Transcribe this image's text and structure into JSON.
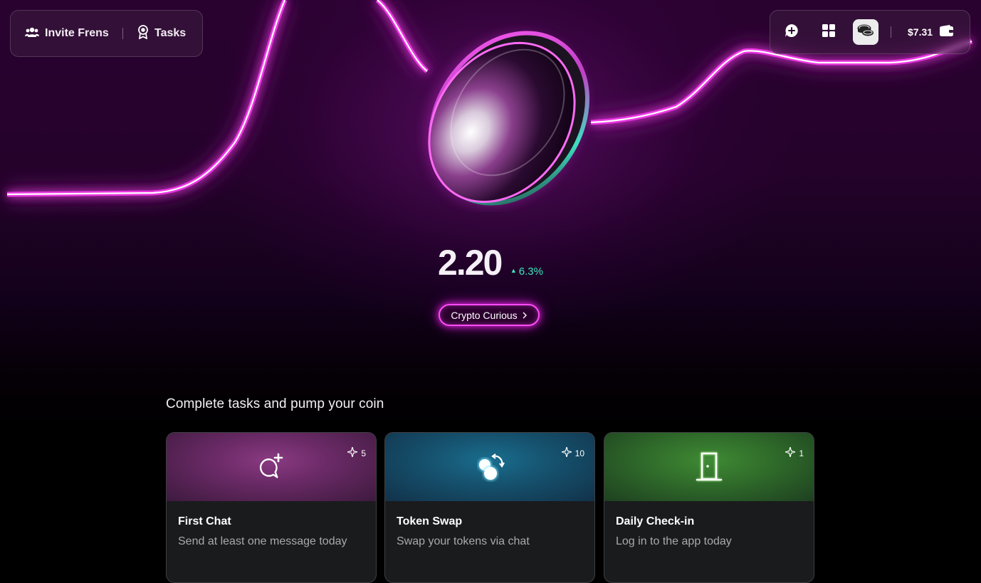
{
  "nav": {
    "invite_label": "Invite Frens",
    "tasks_label": "Tasks",
    "icons": [
      "people-icon",
      "award-icon"
    ]
  },
  "toolbar": {
    "balance": "$7.31",
    "icons": [
      "chat-plus-icon",
      "grid-icon",
      "coins-icon",
      "wallet-icon"
    ],
    "active_icon": "coins-icon"
  },
  "coin": {
    "price": "2.20",
    "change": "6.3%",
    "change_color": "#3fe6c3",
    "level_label": "Crypto Curious"
  },
  "section": {
    "title": "Complete tasks and pump your coin"
  },
  "tasks": [
    {
      "title": "First Chat",
      "description": "Send at least one message today",
      "points": "5",
      "icon": "chat-plus-icon",
      "color": "#6a2a66"
    },
    {
      "title": "Token Swap",
      "description": "Swap your tokens via chat",
      "points": "10",
      "icon": "swap-coins-icon",
      "color": "#15506c"
    },
    {
      "title": "Daily Check-in",
      "description": "Log in to the app today",
      "points": "1",
      "icon": "door-icon",
      "color": "#2f6a2a"
    }
  ],
  "colors": {
    "accent": "#ff4df5",
    "positive": "#3fe6c3",
    "background": "#000000"
  }
}
